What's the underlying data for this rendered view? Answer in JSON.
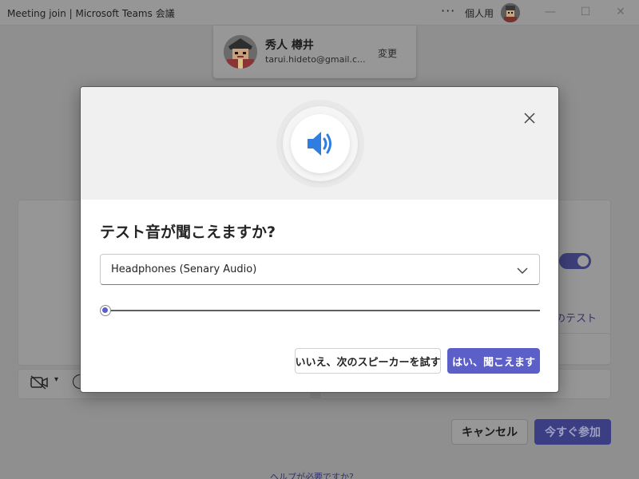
{
  "window": {
    "title": "Meeting join | Microsoft Teams 会議",
    "more_icon": "ellipsis-icon",
    "account_label": "個人用",
    "minimize": "—",
    "maximize": "☐",
    "close": "✕"
  },
  "account": {
    "name": "秀人 樽井",
    "email": "tarui.hideto@gmail.c...",
    "change_label": "変更"
  },
  "background": {
    "speaker_test_label": "ーのテスト",
    "cancel_label": "キャンセル",
    "join_label": "今すぐ参加",
    "help_label": "ヘルプが必要ですか?"
  },
  "dialog": {
    "title": "テスト音が聞こえますか?",
    "hero_icon": "speaker-volume-icon",
    "device": {
      "selected": "Headphones (Senary Audio)"
    },
    "volume_fraction": 0.0,
    "no_label": "いいえ、次のスピーカーを試す",
    "yes_label": "はい、聞こえます"
  },
  "colors": {
    "accent": "#5b5fc7",
    "icon_blue": "#2f7de1",
    "overlay": "#8f8f8f"
  }
}
